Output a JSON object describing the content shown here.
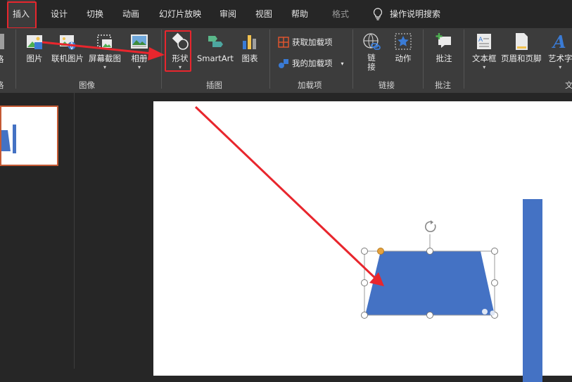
{
  "tabs": [
    {
      "label": "插入",
      "active": true
    },
    {
      "label": "设计"
    },
    {
      "label": "切换"
    },
    {
      "label": "动画"
    },
    {
      "label": "幻灯片放映"
    },
    {
      "label": "审阅"
    },
    {
      "label": "视图"
    },
    {
      "label": "帮助"
    },
    {
      "label": "格式",
      "dim": true
    }
  ],
  "tell_me": {
    "label": "操作说明搜索",
    "icon": "lightbulb-icon"
  },
  "ribbon": {
    "cut_edge_label": "格",
    "cut_edge_group": "格",
    "image_group": {
      "label": "图像",
      "buttons": [
        {
          "label": "图片",
          "icon": "picture-icon"
        },
        {
          "label": "联机图片",
          "icon": "online-picture-icon"
        },
        {
          "label": "屏幕截图",
          "icon": "screenshot-icon"
        },
        {
          "label": "相册",
          "icon": "photo-album-icon"
        }
      ]
    },
    "illustration_group": {
      "label": "插图",
      "buttons": [
        {
          "label": "形状",
          "icon": "shapes-icon"
        },
        {
          "label": "SmartArt",
          "icon": "smartart-icon"
        },
        {
          "label": "图表",
          "icon": "chart-icon"
        }
      ]
    },
    "addins_group": {
      "label": "加载项",
      "get_addins": "获取加载项",
      "my_addins": "我的加载项"
    },
    "links_group": {
      "label": "链接",
      "link_label": "链\n接",
      "action_label": "动作"
    },
    "comments_group": {
      "label": "批注",
      "button": "批注"
    },
    "text_group": {
      "label": "文",
      "textbox": "文本框",
      "header_footer": "页眉和页脚",
      "wordart": "艺术字"
    }
  },
  "colors": {
    "accent_red": "#e8262d",
    "shape_fill": "#4472c4",
    "ribbon_bg": "#3c3c3c",
    "tabbar_bg": "#262626",
    "thumb_border": "#c55a34"
  }
}
